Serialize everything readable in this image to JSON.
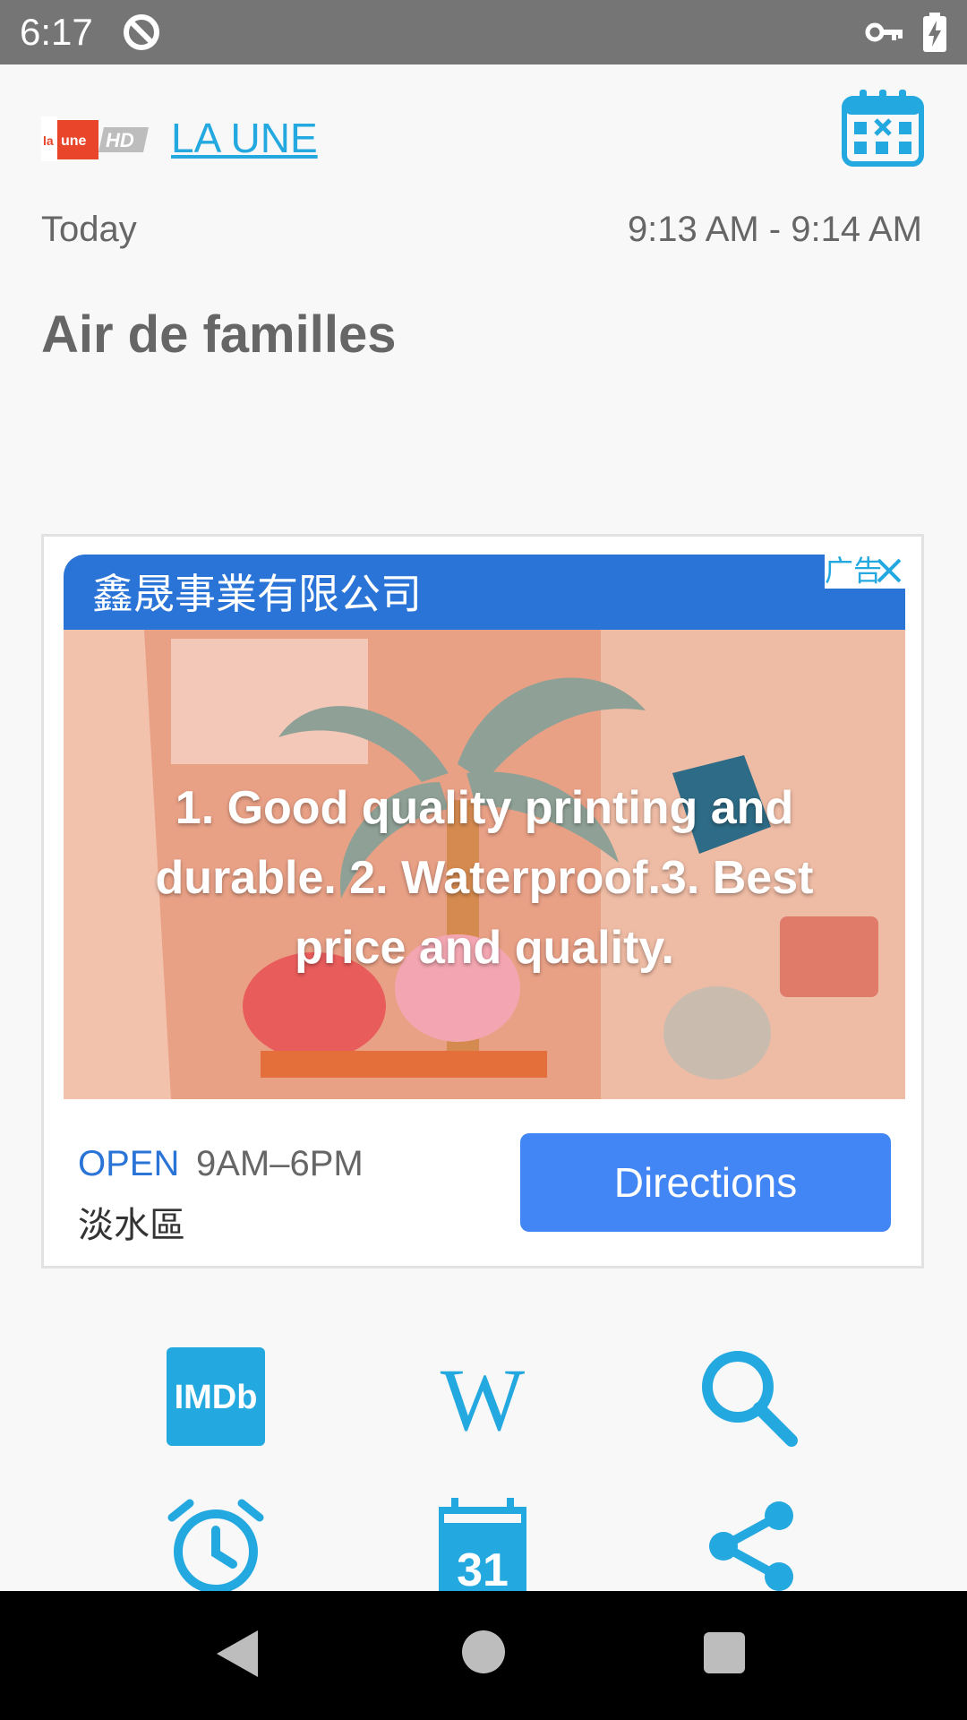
{
  "status_bar": {
    "time": "6:17"
  },
  "header": {
    "channel_link": "LA UNE",
    "logo_alt": "la une HD",
    "date_label": "Today",
    "time_range": "9:13 AM - 9:14 AM",
    "program_title": "Air de familles"
  },
  "ad": {
    "header_text": "鑫晟事業有限公司",
    "badge_label": "广告",
    "media_text": "1. Good quality printing and durable. 2. Waterproof.3. Best price and quality.",
    "open_label": "OPEN",
    "hours": "9AM–6PM",
    "district": "淡水區",
    "directions_label": "Directions"
  },
  "actions": {
    "row1": [
      "imdb-icon",
      "wikipedia-icon",
      "search-icon"
    ],
    "row2": [
      "alarm-icon",
      "calendar-31-icon",
      "share-icon"
    ],
    "imdb_label": "IMDb",
    "calendar_day": "31"
  },
  "colors": {
    "accent": "#23a8e0",
    "ad_blue": "#2a74d8",
    "button_blue": "#4285f4",
    "status_bar": "#757575"
  }
}
